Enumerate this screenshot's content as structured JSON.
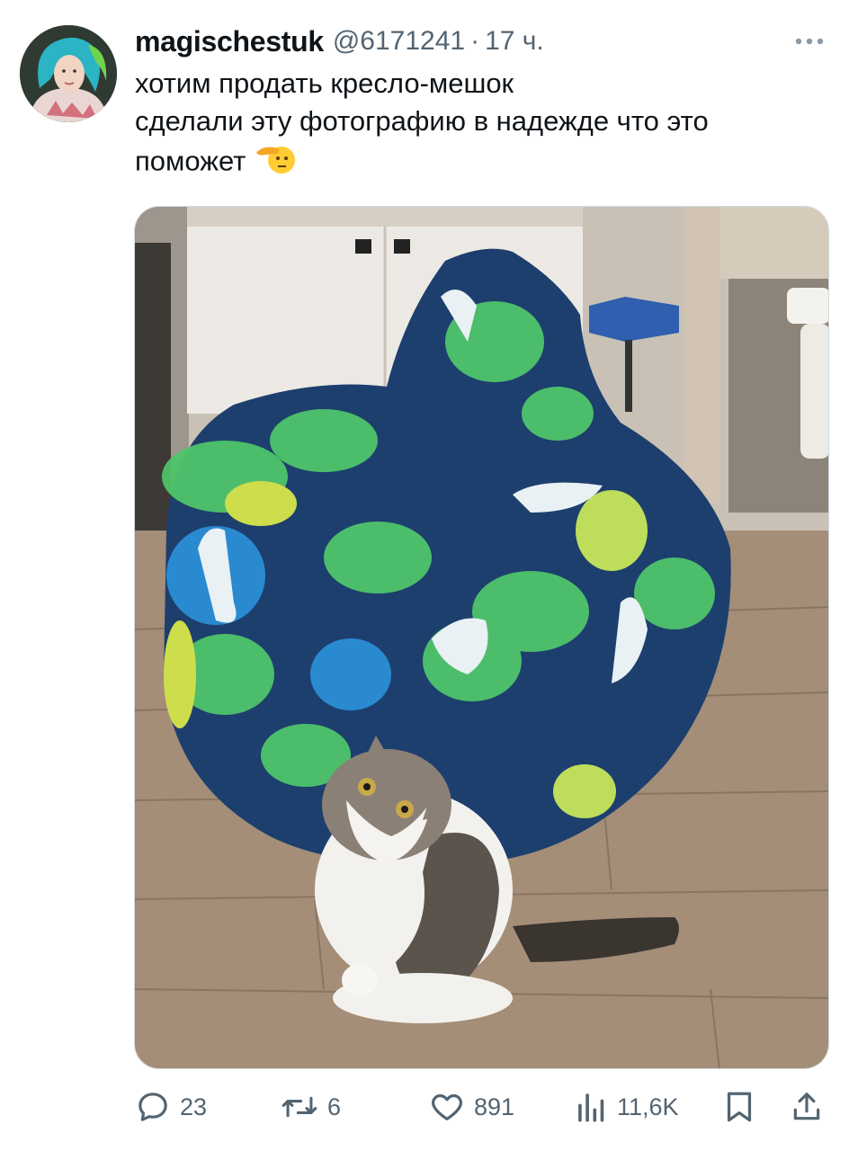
{
  "tweet": {
    "username": "magischestuk",
    "handle": "@6171241",
    "separator": "·",
    "time": "17 ч.",
    "text_lines": [
      "хотим продать кресло-мешок",
      "сделали эту фотографию в надежде что это",
      "поможет"
    ],
    "emoji": "saluting-face-emoji"
  },
  "media": {
    "content": "photo-beanbag-dinosaur-print-and-cat"
  },
  "actions": {
    "reply": {
      "icon": "reply-icon",
      "count": "23"
    },
    "retweet": {
      "icon": "retweet-icon",
      "count": "6"
    },
    "like": {
      "icon": "heart-icon",
      "count": "891"
    },
    "views": {
      "icon": "views-icon",
      "count": "11,6K"
    },
    "bookmark": {
      "icon": "bookmark-icon"
    },
    "share": {
      "icon": "share-icon"
    }
  },
  "colors": {
    "text_primary": "#0f1419",
    "text_secondary": "#536471",
    "beanbag_navy": "#1d3f6e",
    "beanbag_green": "#4fc46a",
    "floor": "#a48e78"
  }
}
